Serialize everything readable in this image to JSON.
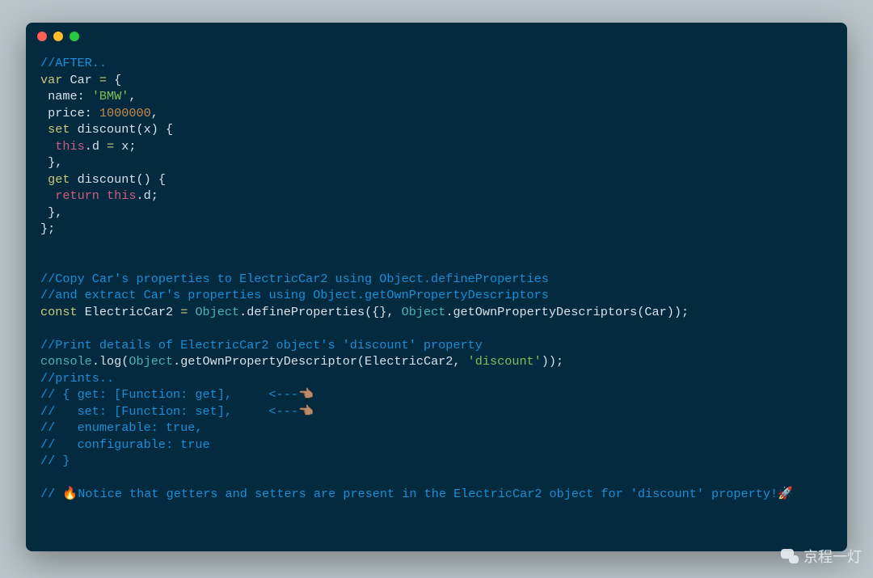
{
  "code": {
    "l01": "//AFTER..",
    "l02a": "var",
    "l02b": " Car ",
    "l02c": "=",
    "l02d": " {",
    "l03a": " name: ",
    "l03b": "'BMW'",
    "l03c": ",",
    "l04a": " price: ",
    "l04b": "1000000",
    "l04c": ",",
    "l05a": " set",
    "l05b": " discount(x) {",
    "l06a": "  ",
    "l06b": "this",
    "l06c": ".d ",
    "l06d": "=",
    "l06e": " x;",
    "l07": " },",
    "l08a": " get",
    "l08b": " discount() {",
    "l09a": "  ",
    "l09b": "return this",
    "l09c": ".d;",
    "l10": " },",
    "l11": "};",
    "blank1": "",
    "blank2": "",
    "l12": "//Copy Car's properties to ElectricCar2 using Object.defineProperties",
    "l13": "//and extract Car's properties using Object.getOwnPropertyDescriptors",
    "l14a": "const",
    "l14b": " ElectricCar2 ",
    "l14c": "=",
    "l14d": " ",
    "l14e": "Object",
    "l14f": ".defineProperties({}, ",
    "l14g": "Object",
    "l14h": ".getOwnPropertyDescriptors(Car));",
    "blank3": "",
    "l15": "//Print details of ElectricCar2 object's 'discount' property",
    "l16a": "console",
    "l16b": ".log(",
    "l16c": "Object",
    "l16d": ".getOwnPropertyDescriptor(ElectricCar2, ",
    "l16e": "'discount'",
    "l16f": "));",
    "l17": "//prints..",
    "l18": "// { get: [Function: get],     <---👈🏽",
    "l19": "//   set: [Function: set],     <---👈🏽",
    "l20": "//   enumerable: true,",
    "l21": "//   configurable: true",
    "l22": "// }",
    "blank4": "",
    "l23": "// 🔥Notice that getters and setters are present in the ElectricCar2 object for 'discount' property!🚀"
  },
  "watermark": "京程一灯"
}
